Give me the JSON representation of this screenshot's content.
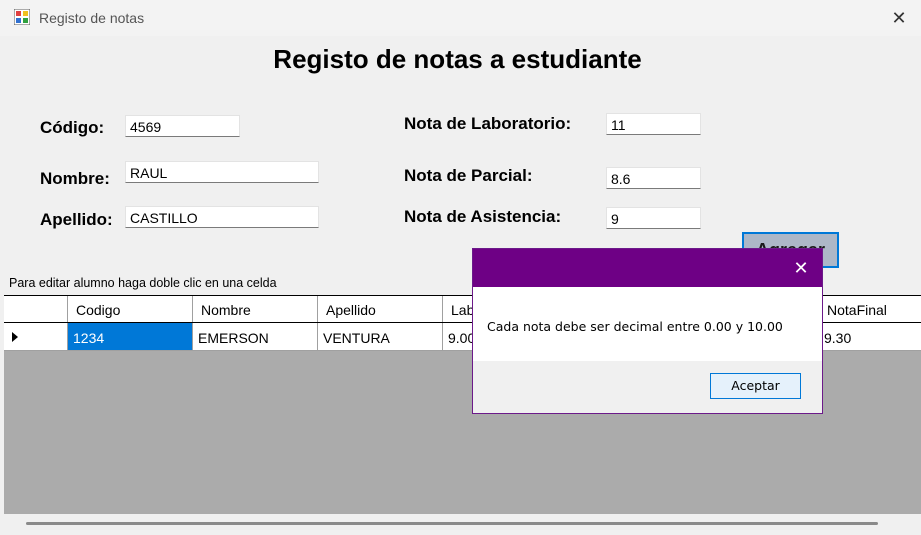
{
  "window": {
    "title": "Registo de notas",
    "close_glyph": "✕"
  },
  "form": {
    "heading": "Registo de notas a estudiante",
    "codigo_label": "Código:",
    "codigo_value": "4569",
    "nombre_label": "Nombre:",
    "nombre_value": "RAUL",
    "apellido_label": "Apellido:",
    "apellido_value": "CASTILLO",
    "lab_label": "Nota de Laboratorio:",
    "lab_value": "11",
    "parcial_label": "Nota de Parcial:",
    "parcial_value": "8.6",
    "asistencia_label": "Nota de Asistencia:",
    "asistencia_value": "9",
    "agregar_label": "Agregar",
    "hint": "Para editar alumno haga doble clic en una celda"
  },
  "grid": {
    "columns": [
      "Codigo",
      "Nombre",
      "Apellido",
      "Lab",
      "NotaFinal"
    ],
    "rows": [
      {
        "codigo": "1234",
        "nombre": "EMERSON",
        "apellido": "VENTURA",
        "lab": "9.00",
        "notafinal": "9.30"
      }
    ]
  },
  "dialog": {
    "message": "Cada nota debe ser decimal entre 0.00 y 10.00",
    "ok_label": "Aceptar",
    "close_glyph": "✕"
  },
  "colors": {
    "dialog_titlebar": "#6e0085",
    "selection": "#0078d7"
  }
}
